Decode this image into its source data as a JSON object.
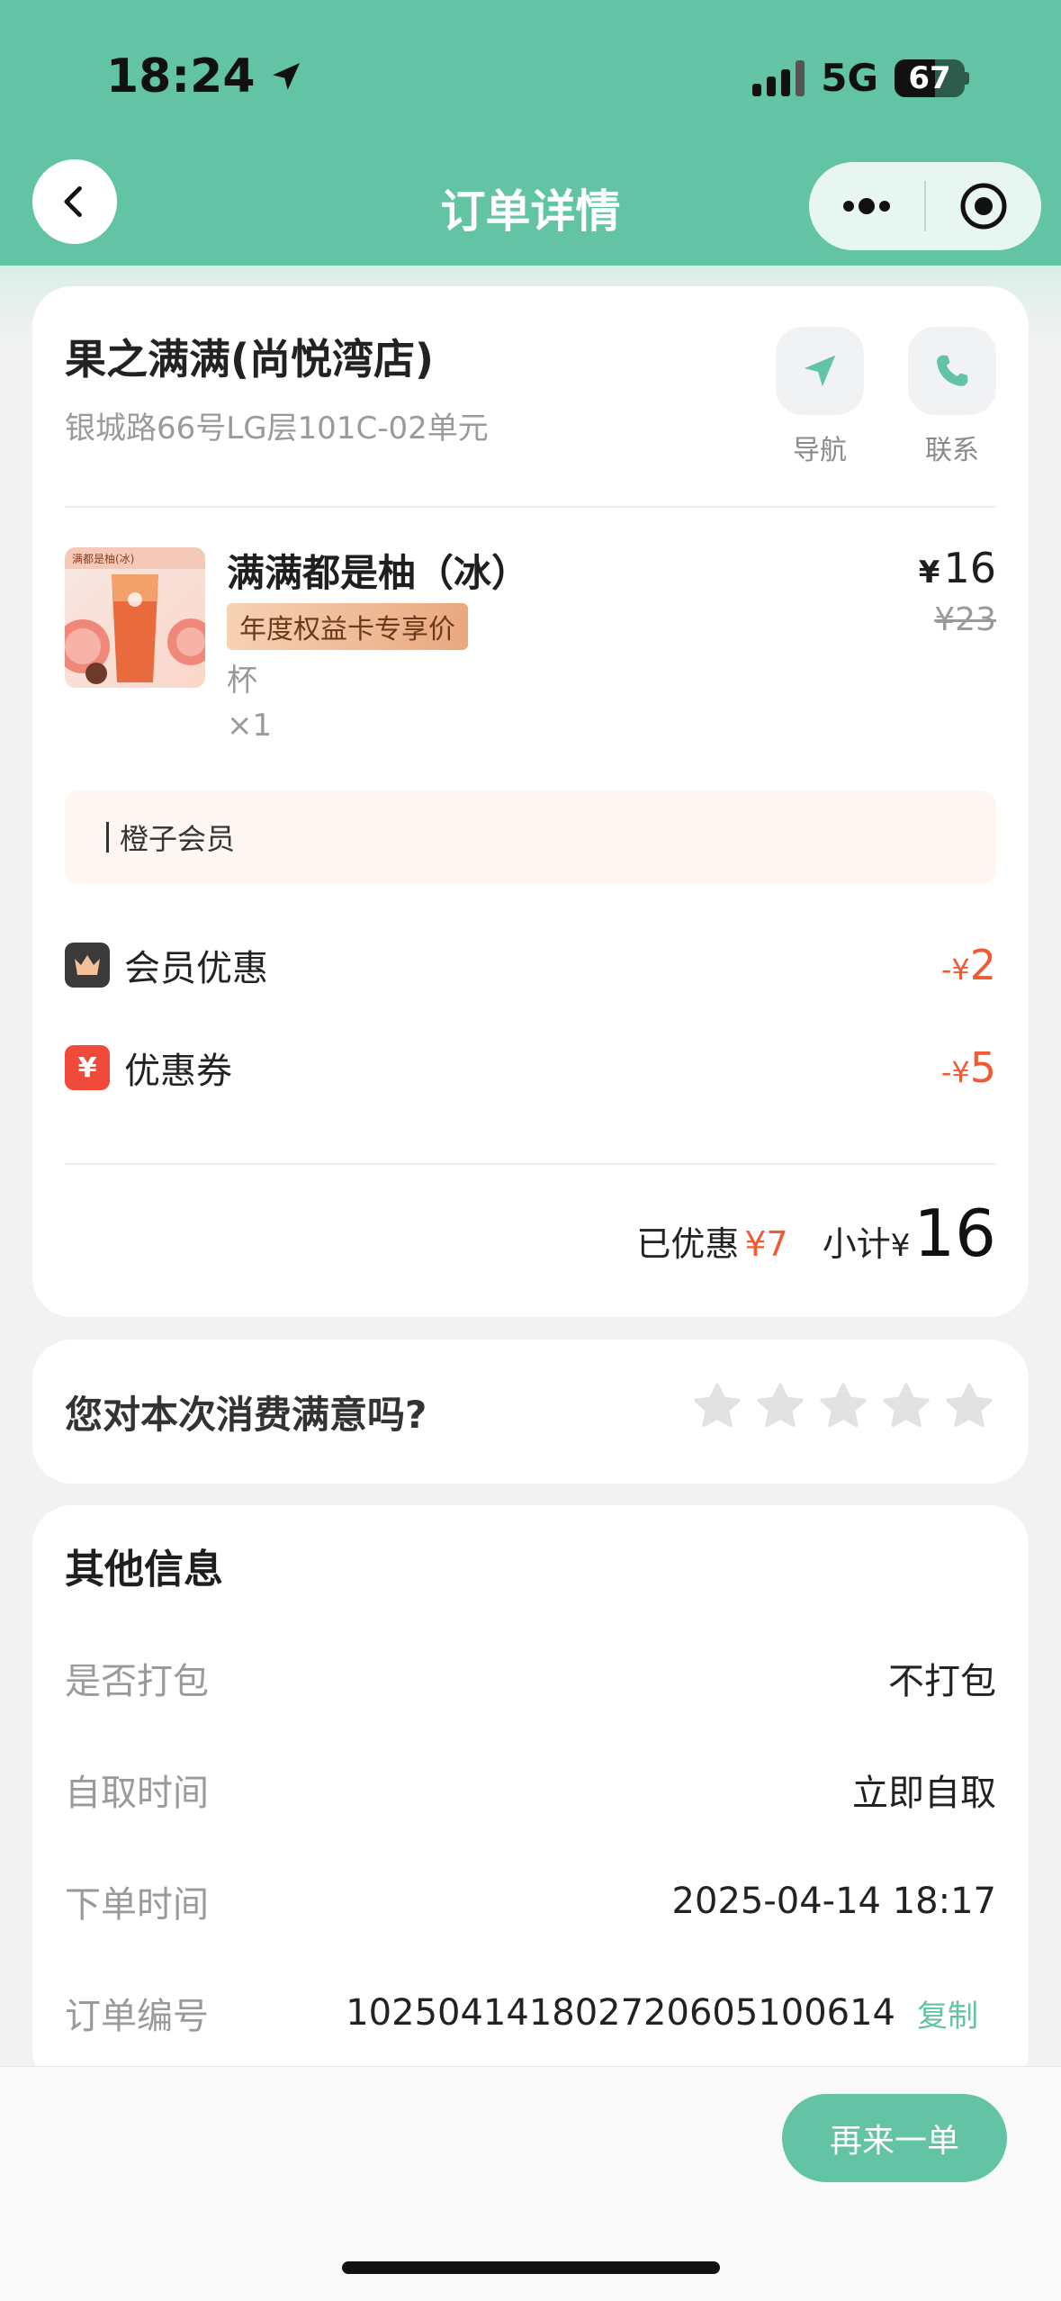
{
  "status_bar": {
    "time": "18:24",
    "network": "5G",
    "battery": "67"
  },
  "header": {
    "title": "订单详情"
  },
  "store": {
    "name": "果之满满(尚悦湾店)",
    "address": "银城路66号LG层101C-02单元",
    "nav_label": "导航",
    "call_label": "联系"
  },
  "product": {
    "name": "满满都是柚（冰）",
    "tag": "年度权益卡专享价",
    "spec": "杯",
    "qty": "×1",
    "price_symbol": "¥",
    "price": "16",
    "original_price": "¥23",
    "thumb_caption": "满都是柚(冰)"
  },
  "member_note": "橙子会员",
  "discounts": [
    {
      "label": "会员优惠",
      "prefix": "-¥",
      "amount": "2",
      "icon": "crown-icon"
    },
    {
      "label": "优惠券",
      "prefix": "-¥",
      "amount": "5",
      "icon": "yen-coupon-icon"
    }
  ],
  "summary": {
    "saved_label": "已优惠",
    "saved_value": "¥7",
    "subtotal_label": "小计",
    "subtotal_symbol": "¥",
    "subtotal_value": "16"
  },
  "rating": {
    "question": "您对本次消费满意吗?",
    "stars": 5,
    "selected": 0
  },
  "other_info": {
    "title": "其他信息",
    "rows": [
      {
        "key": "是否打包",
        "value": "不打包"
      },
      {
        "key": "自取时间",
        "value": "立即自取"
      },
      {
        "key": "下单时间",
        "value": "2025-04-14 18:17"
      },
      {
        "key": "订单编号",
        "value": "10250414180272060510061​4"
      }
    ],
    "copy_label": "复制"
  },
  "bottom": {
    "reorder_label": "再来一单"
  },
  "colors": {
    "brand": "#62c3a5",
    "discount": "#ef5b34"
  }
}
